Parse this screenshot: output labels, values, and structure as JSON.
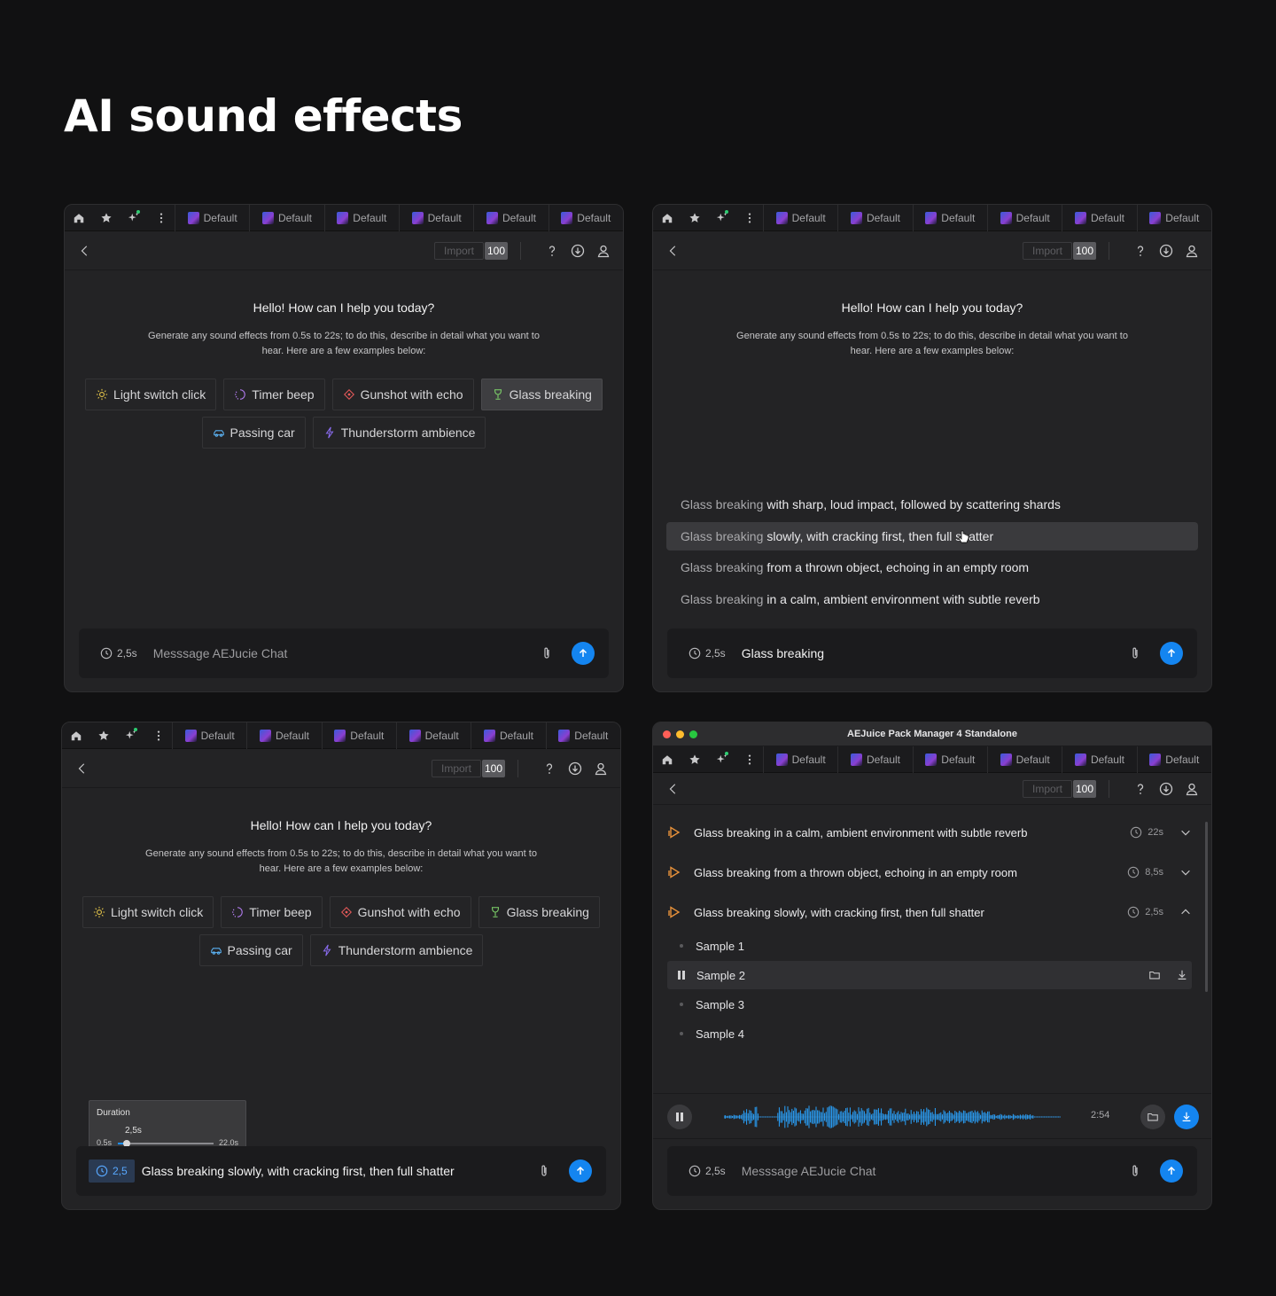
{
  "page_title": "AI sound effects",
  "tabs": [
    "Default",
    "Default",
    "Default",
    "Default",
    "Default",
    "Default"
  ],
  "toolbar": {
    "import_label": "Import",
    "count": "100"
  },
  "greeting": "Hello! How can I help you today?",
  "description_line1": "Generate any sound effects from 0.5s to 22s; to do this, describe in detail what you want to",
  "description_line2": "hear. Here are a few examples below:",
  "chips": [
    {
      "label": "Light switch click",
      "icon": "sun-icon",
      "color": "#e8c84a"
    },
    {
      "label": "Timer beep",
      "icon": "timer-icon",
      "color": "#b27cf0"
    },
    {
      "label": "Gunshot with echo",
      "icon": "target-icon",
      "color": "#e85a5a"
    },
    {
      "label": "Glass breaking",
      "icon": "glass-icon",
      "color": "#7ed36a"
    },
    {
      "label": "Passing car",
      "icon": "car-icon",
      "color": "#5ab0f0"
    },
    {
      "label": "Thunderstorm ambience",
      "icon": "lightning-icon",
      "color": "#8a6cf0"
    }
  ],
  "panel1": {
    "duration": "2,5s",
    "message_placeholder": "Messsage AEJucie Chat"
  },
  "panel2": {
    "suggestion_prefix": "Glass breaking",
    "suggestions": [
      "with sharp, loud impact, followed by scattering shards",
      "slowly, with cracking first, then full shatter",
      "from a thrown object, echoing in an empty room",
      "in a calm, ambient environment with subtle reverb"
    ],
    "duration": "2,5s",
    "message_value": "Glass breaking"
  },
  "panel3": {
    "popup_title": "Duration",
    "popup_value": "2,5s",
    "popup_min": "0.5s",
    "popup_max": "22.0s",
    "slider_fraction": 0.09,
    "duration": "2,5",
    "message_value": "Glass breaking slowly, with cracking first, then full shatter"
  },
  "panel4": {
    "window_title": "AEJuice Pack Manager 4 Standalone",
    "results": [
      {
        "title": "Glass breaking in a calm, ambient environment with subtle reverb",
        "duration": "22s",
        "expanded": false
      },
      {
        "title": "Glass breaking from a thrown object, echoing in an empty room",
        "duration": "8,5s",
        "expanded": false
      },
      {
        "title": "Glass breaking slowly, with cracking first, then full shatter",
        "duration": "2,5s",
        "expanded": true
      }
    ],
    "samples": [
      "Sample 1",
      "Sample 2",
      "Sample 3",
      "Sample 4"
    ],
    "active_sample": "Sample 2",
    "player_time": "2:54",
    "duration": "2,5s",
    "message_placeholder": "Messsage AEJucie Chat"
  },
  "colors": {
    "accent": "#1485f0",
    "play_icon": "#e8913a",
    "background": "#111112",
    "panel": "#232325"
  }
}
